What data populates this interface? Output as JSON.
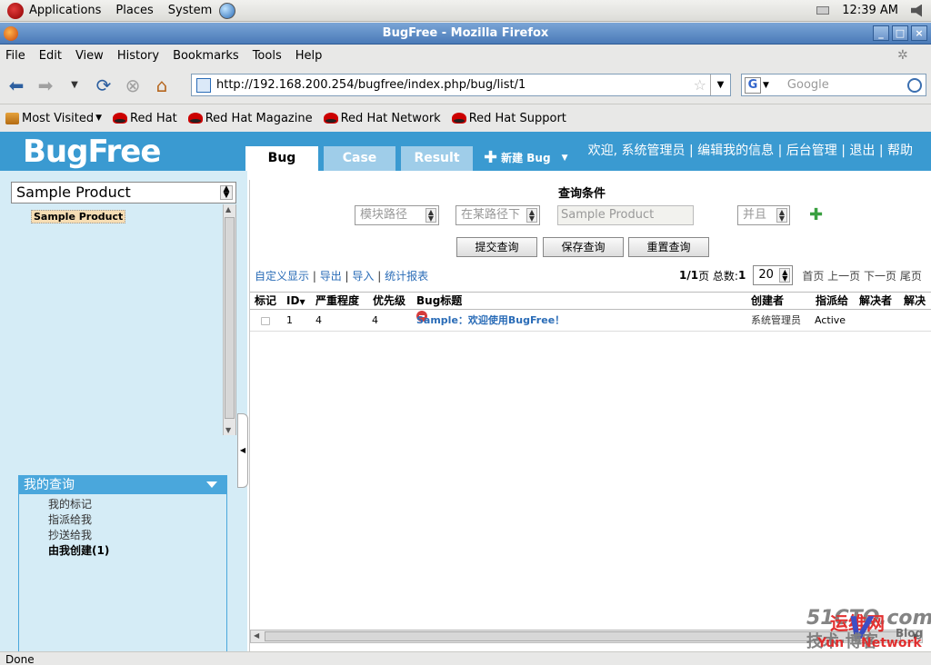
{
  "gnome_panel": {
    "applications": "Applications",
    "places": "Places",
    "system": "System",
    "clock": "12:39 AM"
  },
  "window": {
    "title": "BugFree - Mozilla Firefox",
    "minimize": "_",
    "maximize": "□",
    "close": "×"
  },
  "menu": [
    "File",
    "Edit",
    "View",
    "History",
    "Bookmarks",
    "Tools",
    "Help"
  ],
  "nav": {
    "url": "http://192.168.200.254/bugfree/index.php/bug/list/1",
    "search_placeholder": "Google"
  },
  "bookmarks": [
    "Most Visited",
    "Red Hat",
    "Red Hat Magazine",
    "Red Hat Network",
    "Red Hat Support"
  ],
  "app": {
    "logo": "BugFree",
    "tabs": [
      "Bug",
      "Case",
      "Result"
    ],
    "new_bug": "新建 Bug",
    "userlinks": "欢迎, 系统管理员 | 编辑我的信息 | 后台管理 | 退出 | 帮助"
  },
  "left": {
    "product": "Sample Product",
    "tree_node": "Sample Product",
    "myquery_title": "我的查询",
    "myquery_items": [
      "我的标记",
      "指派给我",
      "抄送给我",
      "由我创建(1)"
    ]
  },
  "query": {
    "title": "查询条件",
    "field1": "模块路径",
    "op1": "在某路径下",
    "value1": "Sample Product",
    "logic": "并且",
    "btn_submit": "提交查询",
    "btn_save": "保存查询",
    "btn_reset": "重置查询"
  },
  "links": {
    "custom": "自定义显示",
    "export": "导出",
    "import": "导入",
    "report": "统计报表"
  },
  "pager": {
    "page": "1/1",
    "page_suffix": "页 总数:",
    "total": "1",
    "page_size": "20",
    "first": "首页",
    "prev": "上一页",
    "next": "下一页",
    "last": "尾页"
  },
  "grid": {
    "headers": [
      "标记",
      "ID",
      "严重程度",
      "优先级",
      "Bug标题",
      "创建者",
      "指派给",
      "解决者",
      "解决"
    ],
    "rows": [
      {
        "id": "1",
        "severity": "4",
        "priority": "4",
        "title": "Sample：欢迎使用BugFree！",
        "creator": "系统管理员",
        "assignee": "Active"
      }
    ]
  },
  "watermark": {
    "top": "51CTO.com",
    "red": "运维网",
    "bottom": "技术·博客",
    "yun": "Yun",
    "net": "Network",
    "blog": "Blog"
  },
  "status": "Done"
}
